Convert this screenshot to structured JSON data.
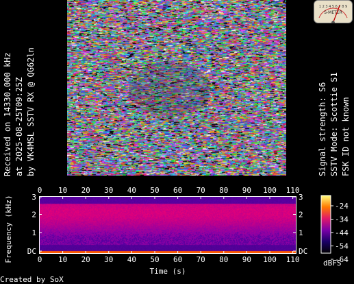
{
  "left_caption": {
    "line1": "Received on  14330.000 kHz",
    "line2": "at 2025-08-25T09:25Z",
    "line3": "by VK4MSL SSTV RX @ QG62ln"
  },
  "right_caption": {
    "line1": "Signal strength: S6",
    "line2": "SSTV Mode: Scottie S1",
    "line3": "FSK ID not known"
  },
  "s_meter": {
    "scale_text": "1 2 3 4 5 6 7 8 9",
    "label": "S-METER"
  },
  "spectrogram": {
    "x_ticks": [
      "0",
      "10",
      "20",
      "30",
      "40",
      "50",
      "60",
      "70",
      "80",
      "90",
      "100",
      "110"
    ],
    "y_ticks_left": [
      "3",
      "2",
      "1",
      "DC"
    ],
    "y_ticks_right": [
      "3",
      "2",
      "1",
      "DC"
    ],
    "y_label": "Frequency (kHz)",
    "x_label": "Time (s)",
    "colorbar_ticks": [
      "-24",
      "-34",
      "-44",
      "-54",
      "-64"
    ],
    "colorbar_unit": "dBFS"
  },
  "footer": {
    "credit": "Created by SoX"
  }
}
